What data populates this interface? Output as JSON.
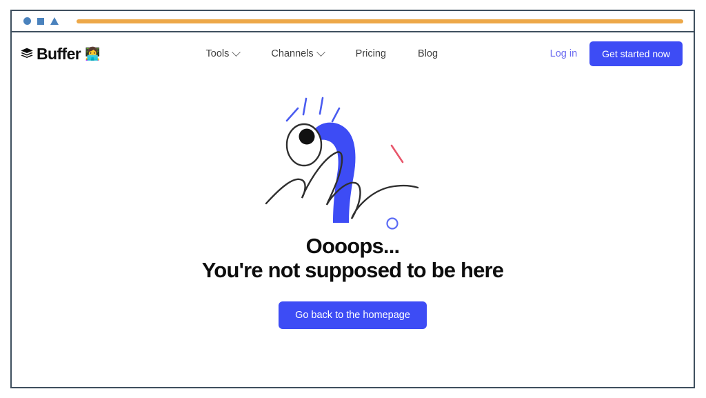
{
  "browser_chrome": {
    "shape_icons": [
      "circle-icon",
      "square-icon",
      "triangle-icon"
    ],
    "url_bar_color": "#eda848",
    "shape_color": "#4a82bd",
    "frame_border_color": "#3e4f5e"
  },
  "header": {
    "logo": {
      "text": "Buffer",
      "mark_icon": "layers-stack-icon",
      "emoji": "👩‍💻"
    },
    "nav": [
      {
        "label": "Tools",
        "has_dropdown": true
      },
      {
        "label": "Channels",
        "has_dropdown": true
      },
      {
        "label": "Pricing",
        "has_dropdown": false
      },
      {
        "label": "Blog",
        "has_dropdown": false
      }
    ],
    "login_label": "Log in",
    "cta_label": "Get started now",
    "accent_color": "#3d4cf5",
    "link_color": "#6b6bf0"
  },
  "error_page": {
    "illustration_name": "blue-worm-surprised-eye-illustration",
    "illustration_colors": {
      "creature_blue": "#3d4cf5",
      "spark_blue": "#4a5cf0",
      "scribble_dark": "#2f2f2f",
      "dash_red": "#e8566b",
      "circle_blue": "#5b6bf5"
    },
    "headline_line1": "Oooops...",
    "headline_line2": "You're not supposed to be here",
    "button_label": "Go back to the homepage",
    "button_color": "#3d4cf5",
    "text_color": "#0d0d0d"
  }
}
